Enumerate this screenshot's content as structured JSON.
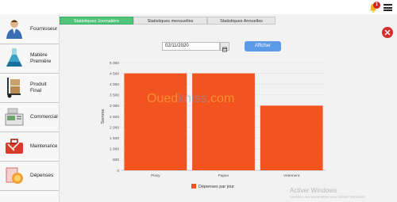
{
  "header": {
    "notification_count": "1",
    "bell_icon": "bell-icon",
    "menu_icon": "hamburger-icon"
  },
  "sidebar": {
    "items": [
      {
        "label": "Fournisseur",
        "icon": "supplier-person-icon"
      },
      {
        "label": "Matière Première",
        "icon": "flask-icon"
      },
      {
        "label": "Produit Final",
        "icon": "hand-truck-icon"
      },
      {
        "label": "Commercial",
        "icon": "cash-register-icon"
      },
      {
        "label": "Maintenance",
        "icon": "toolbox-icon"
      },
      {
        "label": "Dépenses",
        "icon": "expenses-icon"
      }
    ]
  },
  "tabs": [
    {
      "label": "Statistiques Journalière"
    },
    {
      "label": "Statistiques mensuelles"
    },
    {
      "label": "Statistiques Annuelles"
    }
  ],
  "filter": {
    "date_value": "02/11/2020",
    "calendar_icon": "calendar-icon",
    "button_label": "Afficher"
  },
  "colors": {
    "accent_tab": "#4fc47a",
    "button": "#5a9ae6",
    "bar": "#f2531f",
    "close": "#d42b2b"
  },
  "chart_data": {
    "type": "bar",
    "categories": [
      "Pissy",
      "Papier",
      "Vetement"
    ],
    "series": [
      {
        "name": "Dépenses par jour",
        "values": [
          4500,
          4500,
          3000
        ]
      }
    ],
    "ylabel": "Somme",
    "ylim": [
      0,
      5000
    ],
    "yticks": [
      "0",
      "500",
      "1 000",
      "1 500",
      "2 000",
      "2 500",
      "3 000",
      "3 500",
      "4 000",
      "4 500",
      "5 000"
    ],
    "grid": true,
    "legend_position": "bottom"
  },
  "watermark": {
    "part1": "Oued",
    "part2": "kniss",
    "part3": ".com"
  },
  "os_notice": {
    "line1": "Activer Windows",
    "line2": "Accédez aux paramètres pour activer Windows."
  }
}
